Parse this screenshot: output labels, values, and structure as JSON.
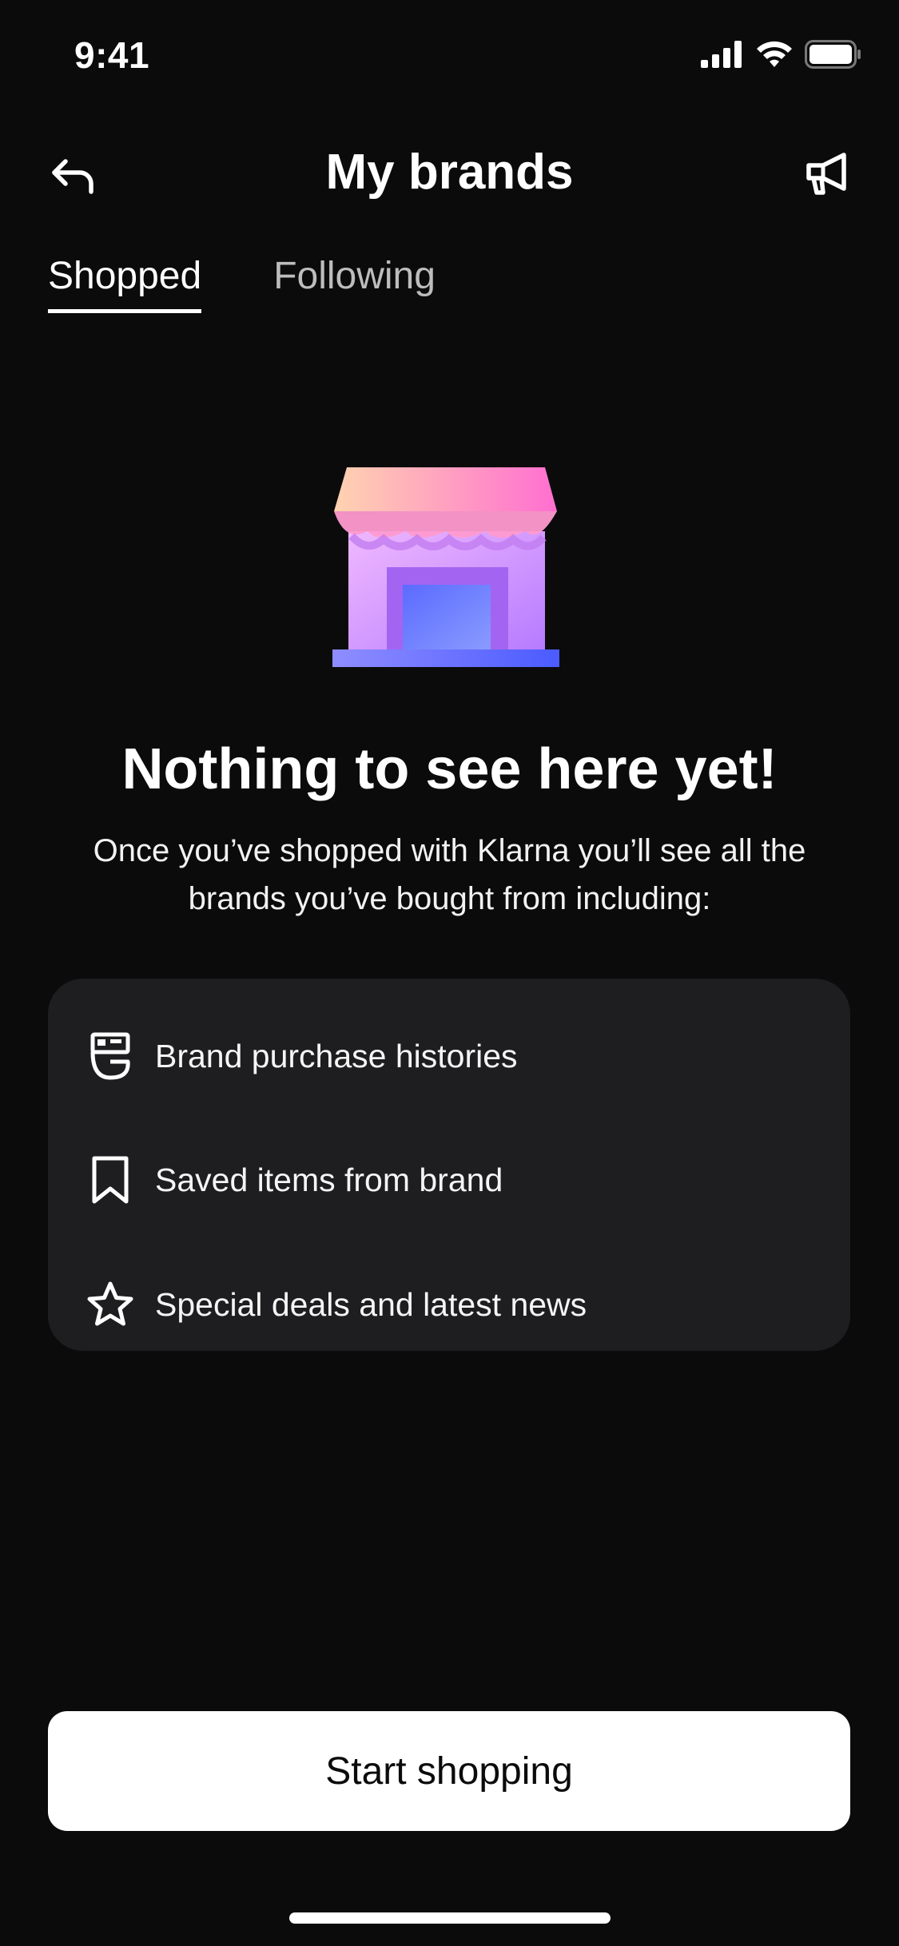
{
  "status_bar": {
    "time": "9:41",
    "icons": [
      "cellular-signal-icon",
      "wifi-icon",
      "battery-icon"
    ]
  },
  "header": {
    "title": "My brands",
    "back_icon": "back-arrow-icon",
    "action_icon": "megaphone-icon"
  },
  "tabs": [
    {
      "label": "Shopped",
      "active": true
    },
    {
      "label": "Following",
      "active": false
    }
  ],
  "illustration": {
    "icon": "storefront-icon"
  },
  "empty_state": {
    "title": "Nothing to see here yet!",
    "description": "Once you’ve shopped with Klarna you’ll see all the brands you’ve bought from including:"
  },
  "features": [
    {
      "icon": "receipt-icon",
      "label": "Brand purchase histories"
    },
    {
      "icon": "bookmark-icon",
      "label": "Saved items from brand"
    },
    {
      "icon": "star-icon",
      "label": "Special deals and latest news"
    }
  ],
  "cta": {
    "label": "Start shopping"
  },
  "colors": {
    "background": "#0b0b0c",
    "card": "#1e1e20",
    "text_primary": "#ffffff",
    "text_muted": "#bdbdbd",
    "button_bg": "#ffffff",
    "button_text": "#0b0b0c"
  }
}
